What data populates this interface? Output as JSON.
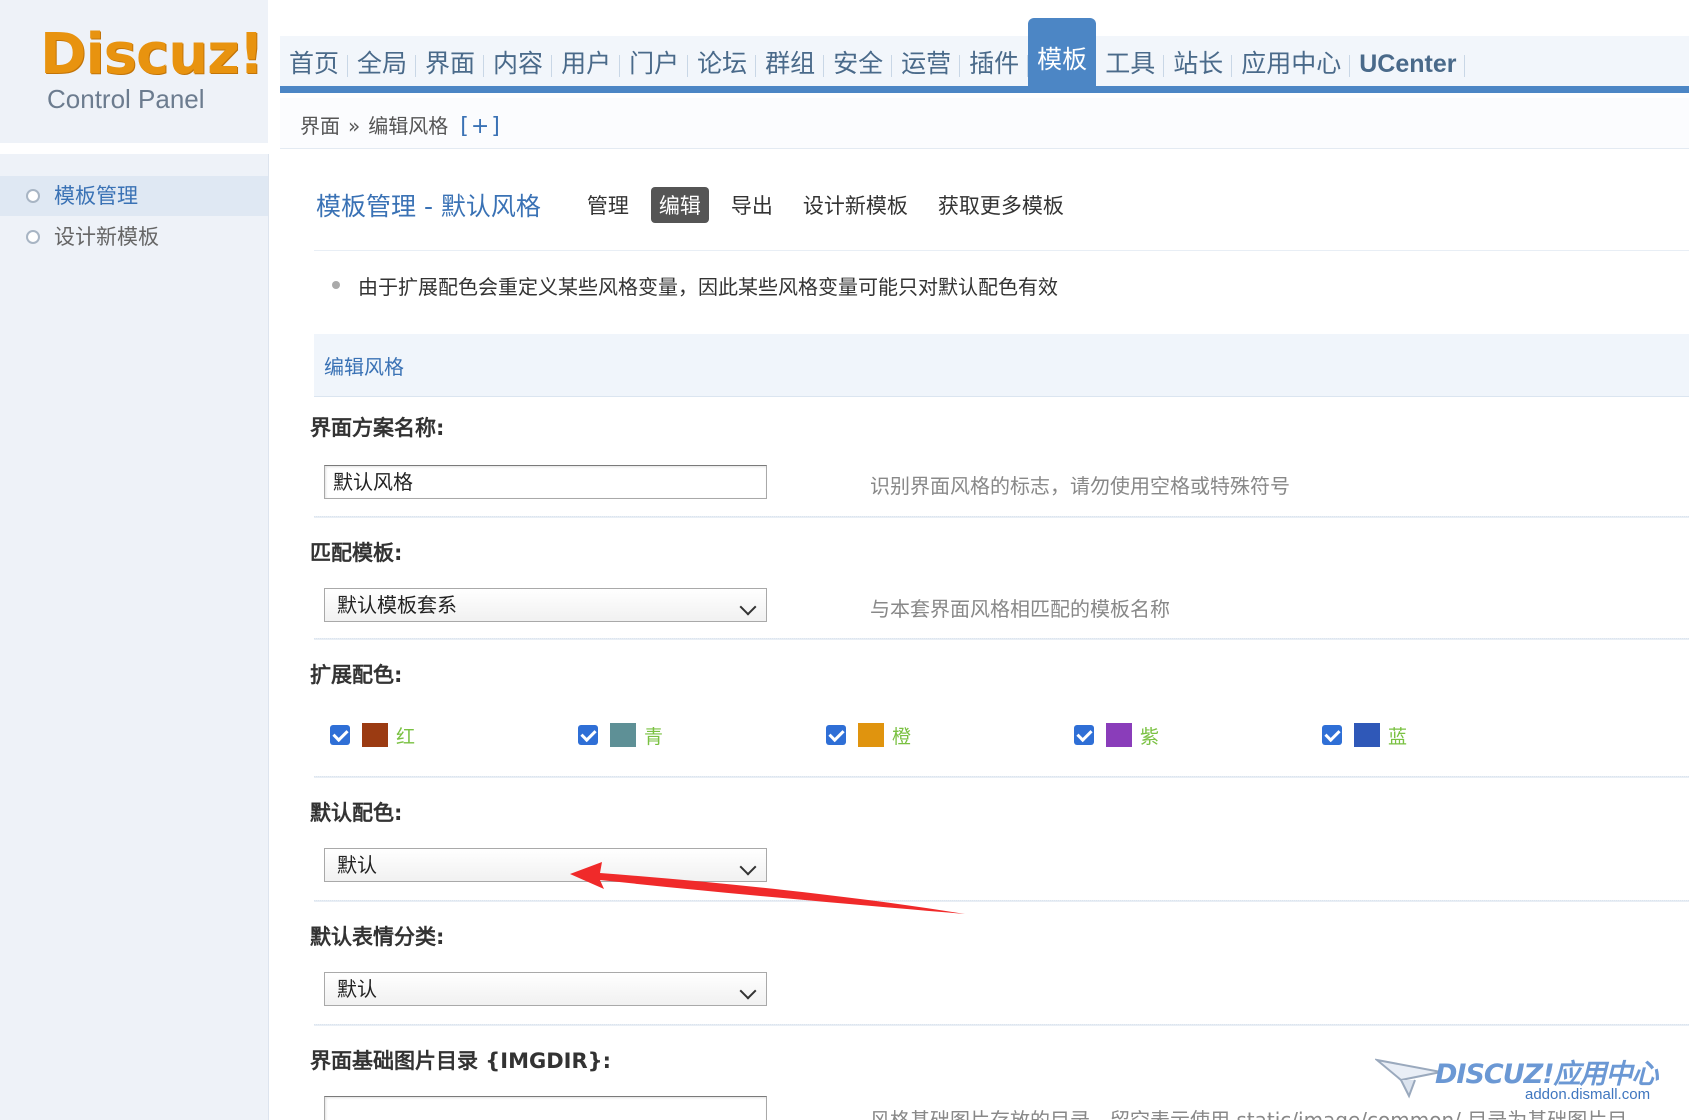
{
  "logo": {
    "main": "Discuz!",
    "sub": "Control Panel"
  },
  "nav": {
    "items": [
      {
        "label": "首页"
      },
      {
        "label": "全局"
      },
      {
        "label": "界面"
      },
      {
        "label": "内容"
      },
      {
        "label": "用户"
      },
      {
        "label": "门户"
      },
      {
        "label": "论坛"
      },
      {
        "label": "群组"
      },
      {
        "label": "安全"
      },
      {
        "label": "运营"
      },
      {
        "label": "插件"
      },
      {
        "label": "模板"
      },
      {
        "label": "工具"
      },
      {
        "label": "站长"
      },
      {
        "label": "应用中心"
      },
      {
        "label": "UCenter"
      }
    ],
    "active_label": "模板"
  },
  "breadcrumb": {
    "root": "界面",
    "sep": "»",
    "current": "编辑风格",
    "add": "[+]"
  },
  "sidebar": {
    "items": [
      {
        "label": "模板管理"
      },
      {
        "label": "设计新模板"
      }
    ]
  },
  "main": {
    "title": "模板管理 - 默认风格",
    "tabs": [
      {
        "label": "管理"
      },
      {
        "label": "编辑"
      },
      {
        "label": "导出"
      },
      {
        "label": "设计新模板"
      },
      {
        "label": "获取更多模板"
      }
    ],
    "active_tab": "编辑",
    "tip": "由于扩展配色会重定义某些风格变量，因此某些风格变量可能只对默认配色有效",
    "section_title": "编辑风格",
    "fields": {
      "scheme_name": {
        "label": "界面方案名称:",
        "value": "默认风格",
        "desc": "识别界面风格的标志，请勿使用空格或特殊符号"
      },
      "match_template": {
        "label": "匹配模板:",
        "value": "默认模板套系",
        "desc": "与本套界面风格相匹配的模板名称"
      },
      "ext_colors": {
        "label": "扩展配色:",
        "options": [
          {
            "name": "红",
            "color": "#9b3b12",
            "checked": true
          },
          {
            "name": "青",
            "color": "#5e9096",
            "checked": true
          },
          {
            "name": "橙",
            "color": "#e0940e",
            "checked": true
          },
          {
            "name": "紫",
            "color": "#8a3dba",
            "checked": true
          },
          {
            "name": "蓝",
            "color": "#2f58b8",
            "checked": true
          }
        ]
      },
      "default_color": {
        "label": "默认配色:",
        "value": "默认"
      },
      "default_smiley": {
        "label": "默认表情分类:",
        "value": "默认"
      },
      "imgdir": {
        "label": "界面基础图片目录 {IMGDIR}:",
        "desc": "风格基础图片存放的目录，留空表示使用 static/image/common/ 目录为基础图片目"
      }
    }
  },
  "watermark": {
    "logo": "DISCUZ!应用中心",
    "url": "addon.dismall.com"
  },
  "colors": {
    "accent": "#4c86c5",
    "link": "#3a72b5",
    "annotation_arrow": "#f02a2a"
  }
}
